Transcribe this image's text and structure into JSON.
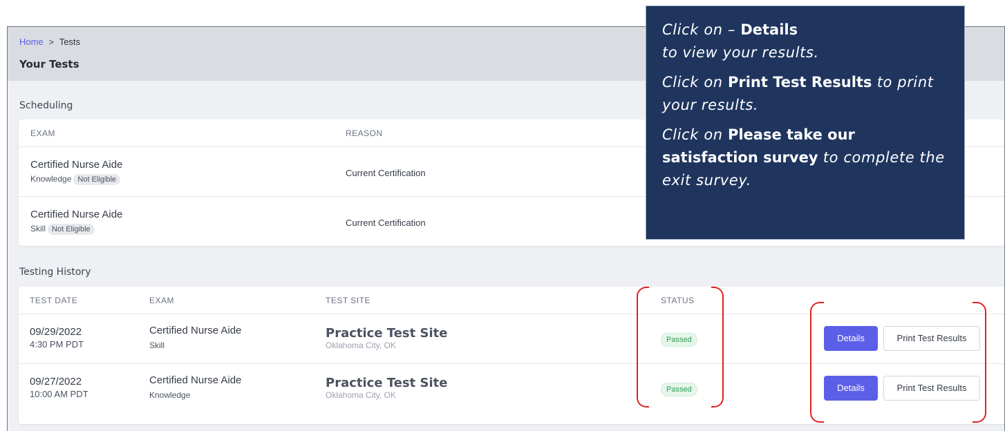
{
  "breadcrumb": {
    "home": "Home",
    "separator": ">",
    "current": "Tests"
  },
  "page_title": "Your Tests",
  "scheduling": {
    "label": "Scheduling",
    "headers": {
      "exam": "EXAM",
      "reason": "REASON"
    },
    "rows": [
      {
        "exam": "Certified Nurse Aide",
        "type": "Knowledge",
        "badge": "Not Eligible",
        "reason": "Current Certification"
      },
      {
        "exam": "Certified Nurse Aide",
        "type": "Skill",
        "badge": "Not Eligible",
        "reason": "Current Certification"
      }
    ]
  },
  "history": {
    "label": "Testing History",
    "headers": {
      "test_date": "TEST DATE",
      "exam": "EXAM",
      "test_site": "TEST SITE",
      "status": "STATUS"
    },
    "rows": [
      {
        "date": "09/29/2022",
        "time": "4:30 PM PDT",
        "exam": "Certified Nurse Aide",
        "type": "Skill",
        "site": "Practice Test Site",
        "location": "Oklahoma City, OK",
        "status": "Passed",
        "details_label": "Details",
        "print_label": "Print Test Results"
      },
      {
        "date": "09/27/2022",
        "time": "10:00 AM PDT",
        "exam": "Certified Nurse Aide",
        "type": "Knowledge",
        "site": "Practice Test Site",
        "location": "Oklahoma City, OK",
        "status": "Passed",
        "details_label": "Details",
        "print_label": "Print Test Results"
      }
    ]
  },
  "callout": {
    "p1_a": "Click on – ",
    "p1_b": "Details",
    "p1_c": "to view your results.",
    "p2_a": "Click on ",
    "p2_b": "Print Test Results",
    "p2_c": " to print your results.",
    "p3_a": "Click on ",
    "p3_b": "Please take our satisfaction survey",
    "p3_c": " to complete the exit survey."
  },
  "colors": {
    "accent": "#5b5fe8",
    "callout_bg": "#1f355e",
    "annotation_red": "#e02020",
    "status_green": "#2f9e55"
  }
}
